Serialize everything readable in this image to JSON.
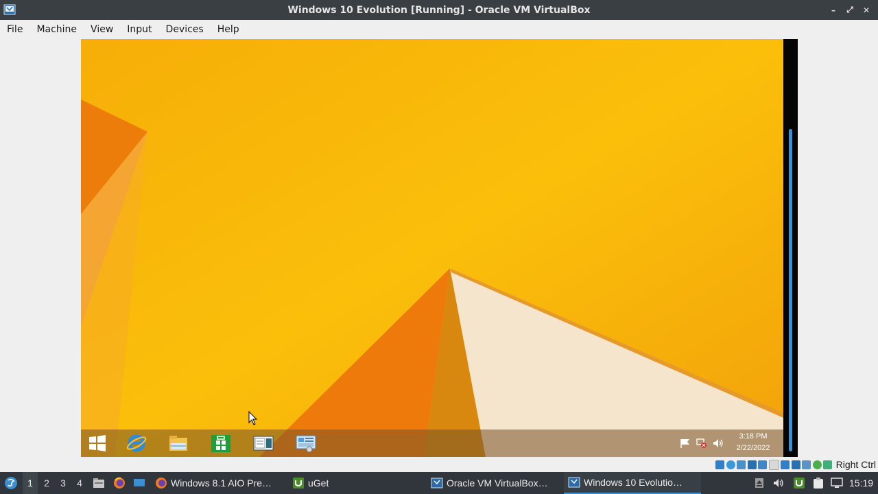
{
  "window": {
    "title": "Windows 10 Evolution [Running] - Oracle VM VirtualBox",
    "buttons": {
      "minimize": "–",
      "maximize": "⤢",
      "close": "✕"
    }
  },
  "menu": [
    "File",
    "Machine",
    "View",
    "Input",
    "Devices",
    "Help"
  ],
  "guest": {
    "clock_time": "3:18 PM",
    "clock_date": "2/22/2022",
    "taskbar_icons": [
      "start-icon",
      "internet-explorer-icon",
      "file-explorer-icon",
      "store-icon",
      "reader-icon",
      "control-panel-icon"
    ],
    "tray_icons": [
      "flag-icon",
      "network-icon",
      "volume-icon"
    ]
  },
  "vbox_status": {
    "host_key": "Right Ctrl"
  },
  "panel": {
    "workspaces": [
      "1",
      "2",
      "3",
      "4"
    ],
    "active_workspace": "1",
    "tasks": [
      "Windows 8.1 AIO Pre…",
      "uGet",
      "Oracle VM VirtualBox…",
      "Windows 10 Evolutio…"
    ],
    "clock": "15:19"
  },
  "colors": {
    "wallpaper": "#f7b708",
    "titlebar": "#3a3f44",
    "panel": "#30363b",
    "accent": "#3c8fd0"
  }
}
